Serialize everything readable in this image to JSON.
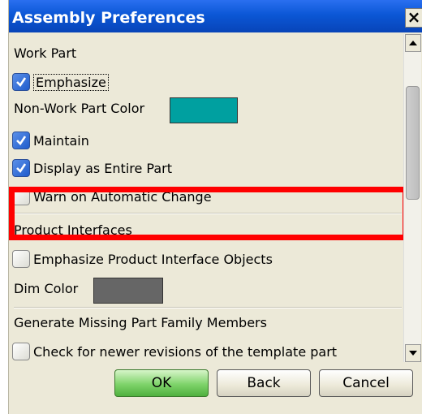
{
  "window": {
    "title": "Assembly Preferences",
    "close_label": "×"
  },
  "work_part": {
    "section_label": "Work Part",
    "emphasize": {
      "label": "Emphasize",
      "checked": true
    },
    "non_work_part_color_label": "Non-Work Part Color",
    "non_work_part_color": "#00a0a0",
    "maintain": {
      "label": "Maintain",
      "checked": true
    },
    "display_entire": {
      "label": "Display as Entire Part",
      "checked": true
    },
    "warn_auto_change": {
      "label": "Warn on Automatic Change",
      "checked": false
    }
  },
  "product_interfaces": {
    "section_label": "Product Interfaces",
    "emphasize_objects": {
      "label": "Emphasize Product Interface Objects",
      "checked": false
    },
    "dim_color_label": "Dim Color",
    "dim_color": "#666666"
  },
  "part_family": {
    "section_label": "Generate Missing Part Family Members",
    "check_newer": {
      "label": "Check for newer revisions of the template part",
      "checked": false
    }
  },
  "buttons": {
    "ok": "OK",
    "back": "Back",
    "cancel": "Cancel"
  },
  "colors": {
    "title_bar": "#0b57d6",
    "highlight": "#ff0000"
  }
}
